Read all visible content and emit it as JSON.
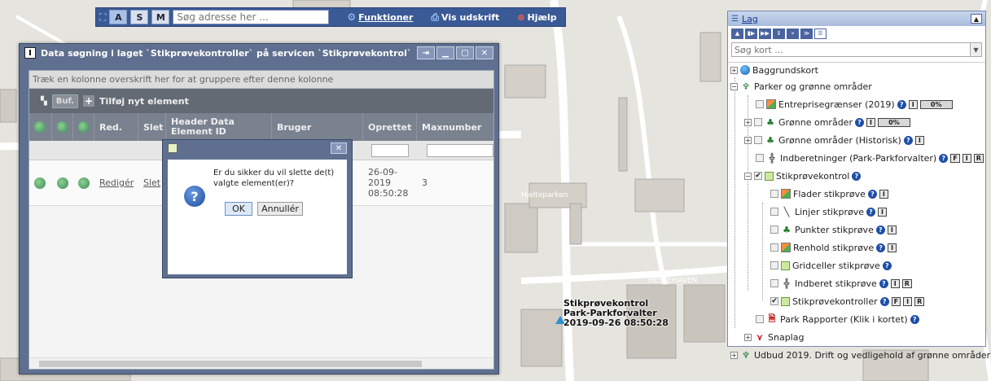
{
  "colors": {
    "titlebar": "#5f6f8f",
    "toolbar": "#3a5a96",
    "accent_link": "#1a3a8a",
    "map_bg": "#e6e4de"
  },
  "toolbar": {
    "modes": [
      "A",
      "S",
      "M"
    ],
    "search_placeholder": "Søg adresse her ...",
    "functions": "Funktioner",
    "print": "Vis udskrift",
    "help": "Hjælp"
  },
  "data_window": {
    "title": "Data søgning i laget `Stikprøvekontroller` på servicen `Stikprøvekontrol`",
    "group_hint": "Træk en kolonne overskrift her for at gruppere efter denne kolonne",
    "buf_label": "Buf.",
    "add_label": "Tilføj nyt element",
    "columns": [
      "Red.",
      "Slet",
      "Header Data Element ID",
      "Bruger",
      "Oprettet",
      "Maxnumber"
    ],
    "row": {
      "edit": "Redigér",
      "delete": "Slet",
      "created": "26-09-2019 08:50:28",
      "maxnumber": "3"
    }
  },
  "dialog": {
    "message": "Er du sikker du vil slette de(t) valgte element(er)?",
    "ok": "OK",
    "cancel": "Annullér"
  },
  "layers_panel": {
    "title": "Lag",
    "search_placeholder": "Søg kort ...",
    "items": [
      {
        "label": "Baggrundskort"
      },
      {
        "label": "Parker og grønne områder"
      },
      {
        "label": "Entreprisegrænser (2019)",
        "pct": "0%"
      },
      {
        "label": "Grønne områder",
        "pct": "0%"
      },
      {
        "label": "Grønne områder (Historisk)"
      },
      {
        "label": "Indberetninger (Park-Parkforvalter)"
      },
      {
        "label": "Stikprøvekontrol"
      },
      {
        "label": "Flader stikprøve"
      },
      {
        "label": "Linjer stikprøve"
      },
      {
        "label": "Punkter stikprøve"
      },
      {
        "label": "Renhold stikprøve"
      },
      {
        "label": "Gridceller stikprøve"
      },
      {
        "label": "Indberet stikprøve"
      },
      {
        "label": "Stikprøvekontroller"
      },
      {
        "label": "Park Rapporter (Klik i kortet)"
      },
      {
        "label": "Snaplag"
      },
      {
        "label": "Udbud 2019. Drift og vedligehold af grønne områder"
      }
    ],
    "tags": {
      "i": "I",
      "f": "F",
      "r": "R"
    }
  },
  "map": {
    "marker_lines": [
      "Stikprøvekontrol",
      "Park-Parkforvalter",
      "2019-09-26 08:50:28"
    ],
    "street_hjelte": "Hjelteparken",
    "street_kirke": "Kirkegårdsvej",
    "street_haven": "HESTEHAVEN"
  }
}
